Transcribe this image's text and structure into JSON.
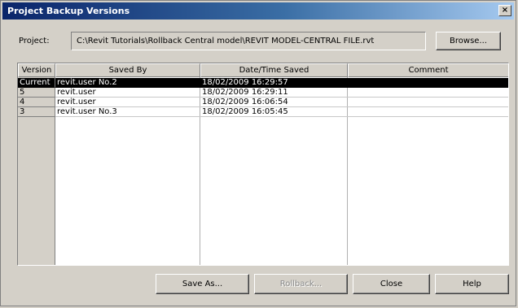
{
  "window": {
    "title": "Project Backup Versions",
    "close_glyph": "×"
  },
  "project": {
    "label": "Project:",
    "path": "C:\\Revit Tutorials\\Rollback Central model\\REVIT MODEL-CENTRAL FILE.rvt",
    "browse_label": "Browse..."
  },
  "table": {
    "columns": [
      "Version",
      "Saved By",
      "Date/Time Saved",
      "Comment"
    ],
    "rows": [
      {
        "version": "Current",
        "saved_by": "revit.user No.2",
        "date": "18/02/2009 16:29:57",
        "comment": ""
      },
      {
        "version": "5",
        "saved_by": "revit.user",
        "date": "18/02/2009 16:29:11",
        "comment": ""
      },
      {
        "version": "4",
        "saved_by": "revit.user",
        "date": "18/02/2009 16:06:54",
        "comment": ""
      },
      {
        "version": "3",
        "saved_by": "revit.user No.3",
        "date": "18/02/2009 16:05:45",
        "comment": ""
      }
    ],
    "selected_index": 0
  },
  "buttons": {
    "save_as": "Save As...",
    "rollback": "Rollback...",
    "close": "Close",
    "help": "Help"
  },
  "colors": {
    "title_bar_start": "#0a246a",
    "title_bar_end": "#a6caf0",
    "dialog_face": "#d4d0c8",
    "selected_row": "#000000"
  }
}
